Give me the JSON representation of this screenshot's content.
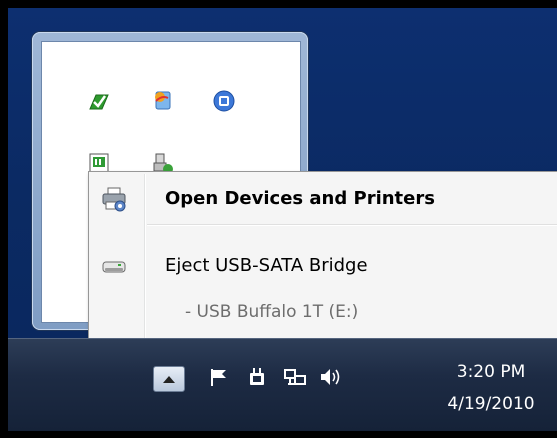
{
  "context_menu": {
    "items": [
      {
        "label": "Open Devices and Printers",
        "icon": "devices-printers-icon",
        "bold": true
      },
      {
        "label": "Eject USB-SATA Bridge",
        "icon": "usb-drive-icon"
      }
    ],
    "sub_item": "-   USB Buffalo 1T (E:)"
  },
  "tray_flyout": {
    "icons": [
      "green-money-icon",
      "colorful-app-icon",
      "blue-circle-icon",
      "green-square-icon",
      "safely-remove-hardware-icon"
    ]
  },
  "taskbar": {
    "icons": [
      "show-hidden-icons-button",
      "action-center-flag-icon",
      "power-plug-icon",
      "network-icon",
      "volume-icon"
    ],
    "clock": {
      "time": "3:20 PM",
      "date": "4/19/2010"
    }
  },
  "colors": {
    "desktop": "#0b2a63",
    "taskbar": "#1d2b44",
    "menu_bg": "#f5f5f5"
  }
}
